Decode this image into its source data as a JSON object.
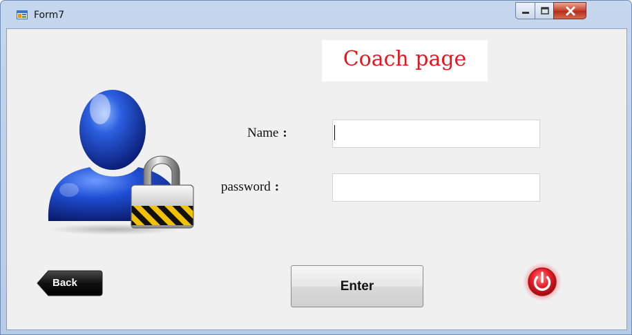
{
  "window": {
    "title": "Form7"
  },
  "form": {
    "title": "Coach page",
    "name_label": "Name",
    "password_label": "password",
    "colon": ":",
    "name_value": "",
    "password_value": ""
  },
  "buttons": {
    "back": "Back",
    "enter": "Enter"
  },
  "icons": {
    "window": "form-icon",
    "avatar": "user-lock-icon",
    "power": "power-icon"
  },
  "colors": {
    "title_text": "#e8151c",
    "power": "#e0202a",
    "client_bg": "#f0f0f0"
  }
}
